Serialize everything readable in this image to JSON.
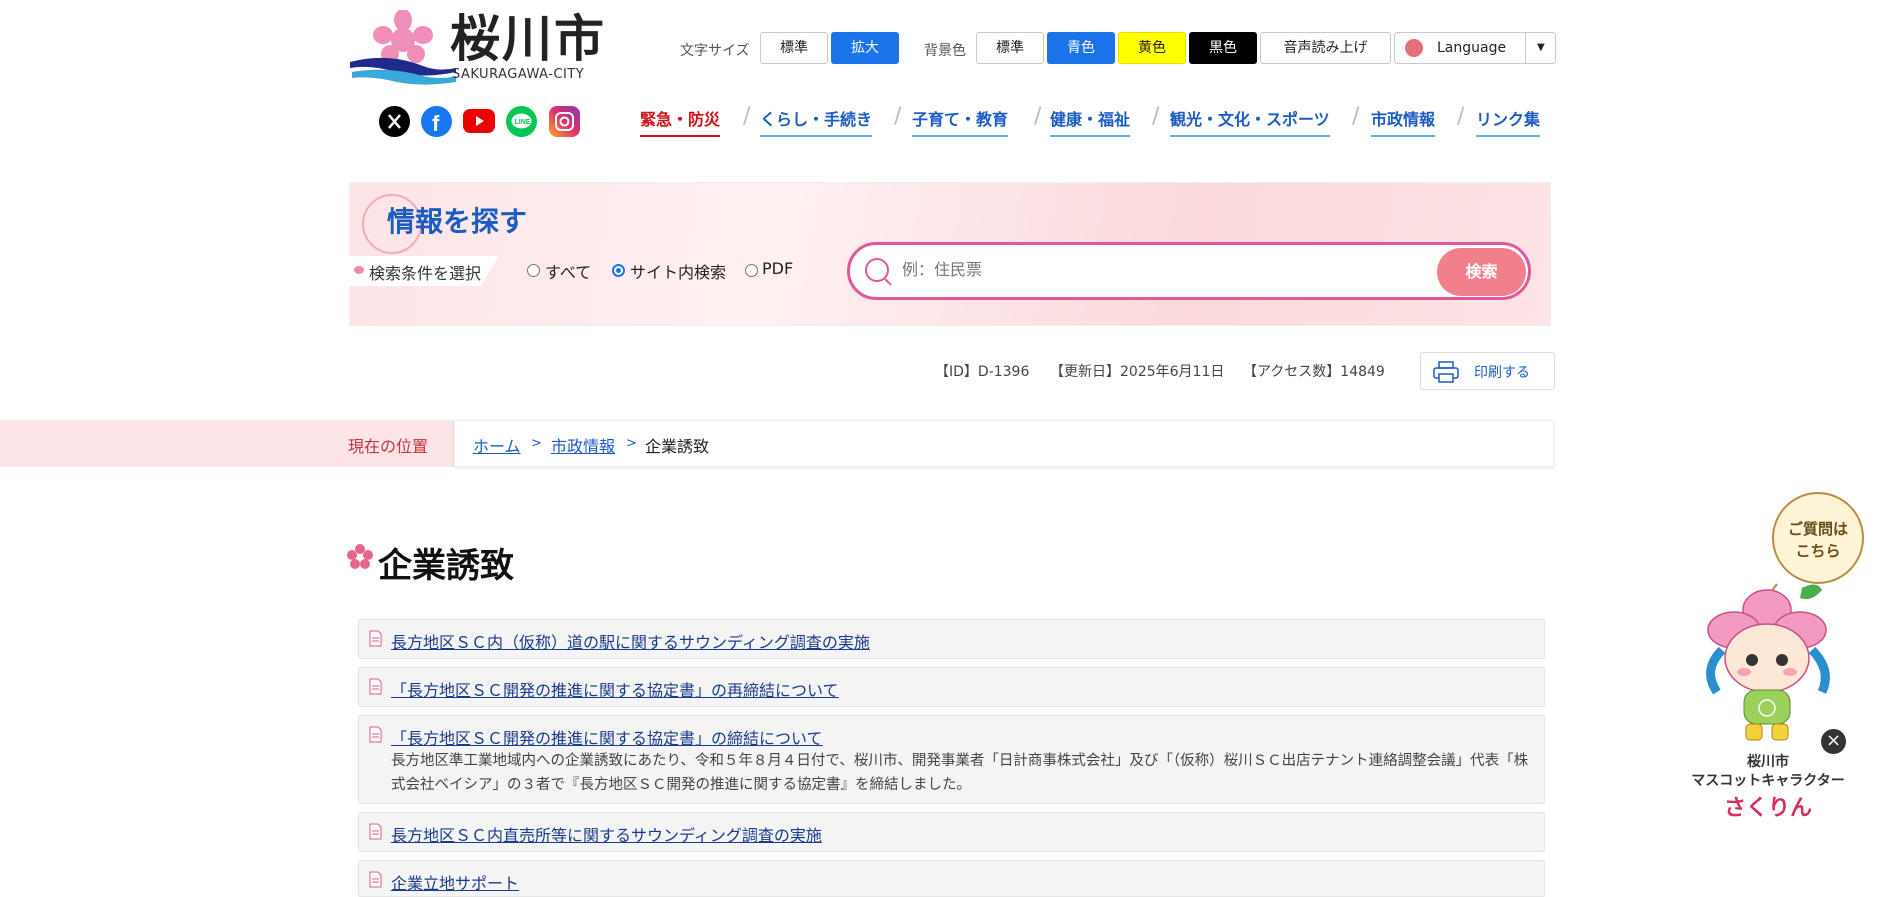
{
  "header": {
    "title": "桜川市",
    "subtitle": "SAKURAGAWA-CITY",
    "font_size_label": "文字サイズ",
    "font_size_options": [
      "標準",
      "拡大"
    ],
    "bg_label": "背景色",
    "bg_options": [
      "標準",
      "青色",
      "黄色",
      "黒色"
    ],
    "voice_label": "音声読み上げ",
    "language_label": "Language"
  },
  "social": [
    "x-icon",
    "facebook-icon",
    "youtube-icon",
    "line-icon",
    "instagram-icon"
  ],
  "nav": {
    "items": [
      "緊急・防災",
      "くらし・手続き",
      "子育て・教育",
      "健康・福祉",
      "観光・文化・スポーツ",
      "市政情報",
      "リンク集"
    ],
    "separator": "/"
  },
  "search": {
    "title": "情報を探す",
    "condition_label": "検索条件を選択",
    "options": [
      "すべて",
      "サイト内検索",
      "PDF"
    ],
    "selected_option": "サイト内検索",
    "placeholder": "例：住民票",
    "button": "検索"
  },
  "meta": {
    "id": "【ID】D-1396",
    "updated": "【更新日】2025年6月11日",
    "access": "【アクセス数】14849",
    "print": "印刷する"
  },
  "breadcrumb": {
    "label": "現在の位置",
    "items": [
      "ホーム",
      "市政情報",
      "企業誘致"
    ],
    "separator": ">"
  },
  "page_title": "企業誘致",
  "links": [
    {
      "title": "長方地区ＳＣ内（仮称）道の駅に関するサウンディング調査の実施"
    },
    {
      "title": "「長方地区ＳＣ開発の推進に関する協定書」の再締結について"
    },
    {
      "title": "「長方地区ＳＣ開発の推進に関する協定書」の締結について",
      "description": "長方地区準工業地域内への企業誘致にあたり、令和５年８月４日付で、桜川市、開発事業者「日計商事株式会社」及び「（仮称）桜川ＳＣ出店テナント連絡調整会議」代表「株式会社ベイシア」の３者で『長方地区ＳＣ開発の推進に関する協定書』を締結しました。"
    },
    {
      "title": "長方地区ＳＣ内直売所等に関するサウンディング調査の実施"
    },
    {
      "title": "企業立地サポート"
    }
  ],
  "mascot": {
    "bubble": [
      "ご質問は",
      "こちら"
    ],
    "caption": [
      "桜川市",
      "マスコットキャラクター"
    ],
    "name": "さくりん",
    "close": "×"
  },
  "colors": {
    "accent_blue": "#1a5cc4",
    "button_blue": "#1a73e8",
    "emergency_red": "#d0121b",
    "pink": "#f1808c",
    "yellow": "#ffff00"
  }
}
